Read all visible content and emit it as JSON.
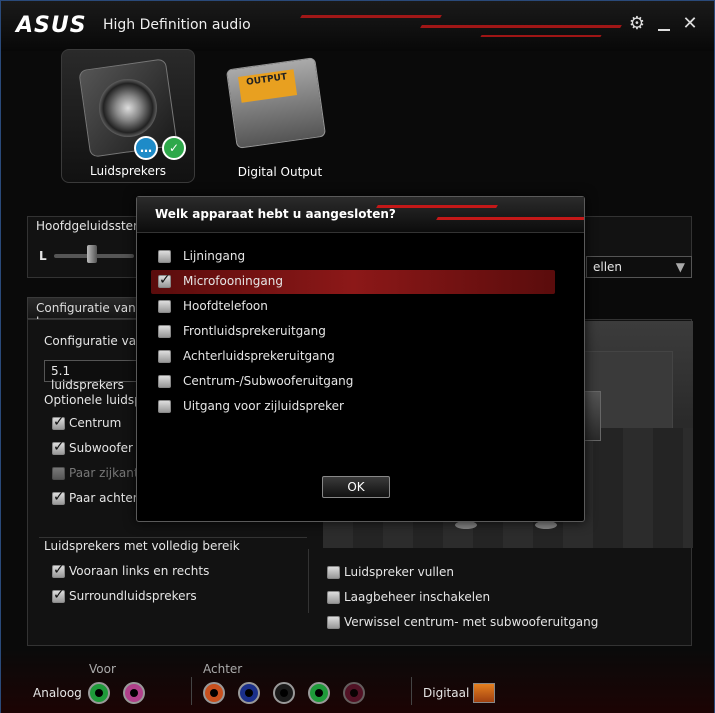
{
  "titlebar": {
    "brand": "ASUS",
    "title": "High Definition audio",
    "settings_icon": "gear-icon",
    "minimize_icon": "minimize-icon",
    "close_icon": "close-icon"
  },
  "devices": [
    {
      "label": "Luidsprekers",
      "icon": "speaker-icon",
      "selected": true
    },
    {
      "label": "Digital Output",
      "icon": "digital-output-icon",
      "selected": false
    }
  ],
  "volume": {
    "label": "Hoofdgeluidssterkt",
    "left_label": "L"
  },
  "right_combo": {
    "value": "ellen"
  },
  "config_tab": {
    "label": "Configuratie van lu"
  },
  "config": {
    "label": "Configuratie van",
    "select_value": "5.1 luidsprekers",
    "optional_label": "Optionele luidspr",
    "options": [
      {
        "label": "Centrum",
        "checked": true,
        "disabled": false
      },
      {
        "label": "Subwoofer",
        "checked": true,
        "disabled": false
      },
      {
        "label": "Paar zijkant",
        "checked": false,
        "disabled": true
      },
      {
        "label": "Paar achteraa",
        "checked": true,
        "disabled": false
      }
    ]
  },
  "fullrange": {
    "label": "Luidsprekers met volledig bereik",
    "options": [
      {
        "label": "Vooraan links en rechts",
        "checked": true
      },
      {
        "label": "Surroundluidsprekers",
        "checked": true
      }
    ]
  },
  "extra_options": [
    {
      "label": "Luidspreker vullen",
      "checked": false
    },
    {
      "label": "Laagbeheer inschakelen",
      "checked": false
    },
    {
      "label": "Verwissel centrum- met subwooferuitgang",
      "checked": false
    }
  ],
  "dialog": {
    "title": "Welk apparaat hebt u aangesloten?",
    "items": [
      {
        "label": "Lijningang",
        "checked": false
      },
      {
        "label": "Microfooningang",
        "checked": true
      },
      {
        "label": "Hoofdtelefoon",
        "checked": false
      },
      {
        "label": "Frontluidsprekeruitgang",
        "checked": false
      },
      {
        "label": "Achterluidsprekeruitgang",
        "checked": false
      },
      {
        "label": "Centrum-/Subwooferuitgang",
        "checked": false
      },
      {
        "label": "Uitgang voor zijluidspreker",
        "checked": false
      }
    ],
    "ok_label": "OK"
  },
  "bottom": {
    "analog_label": "Analoog",
    "front_label": "Voor",
    "back_label": "Achter",
    "digital_label": "Digitaal",
    "front_jacks": [
      "#1e9a3a",
      "#b0408a"
    ],
    "back_jacks": [
      "#c8501e",
      "#1a2f8a",
      "#1a1a1a",
      "#1e9a3a",
      "#7a1a3a"
    ]
  }
}
